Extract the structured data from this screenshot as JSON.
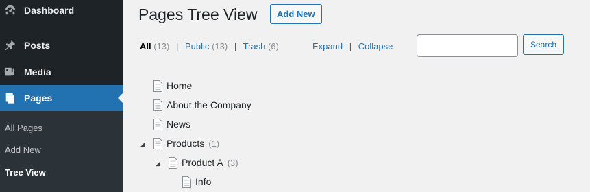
{
  "sidebar": {
    "items": [
      {
        "label": "Dashboard",
        "icon": "dashboard-icon"
      },
      {
        "label": "Posts",
        "icon": "pin-icon"
      },
      {
        "label": "Media",
        "icon": "media-icon"
      },
      {
        "label": "Pages",
        "icon": "page-icon"
      }
    ],
    "submenu": [
      {
        "label": "All Pages"
      },
      {
        "label": "Add New"
      },
      {
        "label": "Tree View"
      }
    ]
  },
  "header": {
    "title": "Pages Tree View",
    "add_new_label": "Add New"
  },
  "filters": {
    "all_label": "All",
    "all_count": "(13)",
    "public_label": "Public",
    "public_count": "(13)",
    "trash_label": "Trash",
    "trash_count": "(6)",
    "separator": "|",
    "expand_label": "Expand",
    "collapse_label": "Collapse"
  },
  "search": {
    "value": "",
    "button_label": "Search"
  },
  "tree": [
    {
      "label": "Home",
      "count": ""
    },
    {
      "label": "About the Company",
      "count": ""
    },
    {
      "label": "News",
      "count": ""
    },
    {
      "label": "Products",
      "count": "(1)"
    },
    {
      "label": "Product A",
      "count": "(3)"
    },
    {
      "label": "Info",
      "count": ""
    }
  ],
  "colors": {
    "accent": "#2271b1",
    "sidebar_bg": "#1d2327",
    "submenu_bg": "#2c3338",
    "page_bg": "#f1f1f1"
  }
}
